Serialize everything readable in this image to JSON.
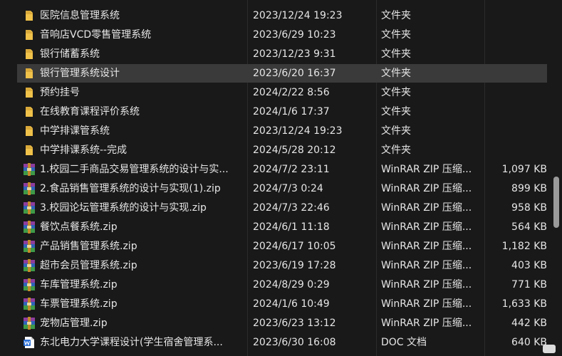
{
  "colors": {
    "background": "#191919",
    "selected_row": "#3a3a3a",
    "folder": "#f0c24a",
    "text": "#e6e6e6"
  },
  "files": [
    {
      "name": "医院信息管理系统",
      "date": "2023/12/24 19:23",
      "type": "文件夹",
      "size": "",
      "icon": "folder-icon"
    },
    {
      "name": "音响店VCD零售管理系统",
      "date": "2023/6/29 10:23",
      "type": "文件夹",
      "size": "",
      "icon": "folder-icon"
    },
    {
      "name": "银行储蓄系统",
      "date": "2023/12/23 9:31",
      "type": "文件夹",
      "size": "",
      "icon": "folder-icon"
    },
    {
      "name": "银行管理系统设计",
      "date": "2023/6/20 16:37",
      "type": "文件夹",
      "size": "",
      "icon": "folder-icon",
      "selected": true
    },
    {
      "name": "预约挂号",
      "date": "2024/2/22 8:56",
      "type": "文件夹",
      "size": "",
      "icon": "folder-icon"
    },
    {
      "name": "在线教育课程评价系统",
      "date": "2024/1/6 17:37",
      "type": "文件夹",
      "size": "",
      "icon": "folder-icon"
    },
    {
      "name": "中学排课管系统",
      "date": "2023/12/24 19:23",
      "type": "文件夹",
      "size": "",
      "icon": "folder-icon"
    },
    {
      "name": "中学排课系统--完成",
      "date": "2024/5/28 20:12",
      "type": "文件夹",
      "size": "",
      "icon": "folder-icon"
    },
    {
      "name": "1.校园二手商品交易管理系统的设计与实...",
      "date": "2024/7/2 23:11",
      "type": "WinRAR ZIP 压缩...",
      "size": "1,097 KB",
      "icon": "winrar-zip-icon"
    },
    {
      "name": "2.食品销售管理系统的设计与实现(1).zip",
      "date": "2024/7/3 0:24",
      "type": "WinRAR ZIP 压缩...",
      "size": "899 KB",
      "icon": "winrar-zip-icon"
    },
    {
      "name": "3.校园论坛管理系统的设计与实现.zip",
      "date": "2024/7/3 22:46",
      "type": "WinRAR ZIP 压缩...",
      "size": "958 KB",
      "icon": "winrar-zip-icon"
    },
    {
      "name": "餐饮点餐系统.zip",
      "date": "2024/6/1 11:18",
      "type": "WinRAR ZIP 压缩...",
      "size": "564 KB",
      "icon": "winrar-zip-icon"
    },
    {
      "name": "产品销售管理系统.zip",
      "date": "2024/6/17 10:05",
      "type": "WinRAR ZIP 压缩...",
      "size": "1,182 KB",
      "icon": "winrar-zip-icon"
    },
    {
      "name": "超市会员管理系统.zip",
      "date": "2023/6/19 17:28",
      "type": "WinRAR ZIP 压缩...",
      "size": "403 KB",
      "icon": "winrar-zip-icon"
    },
    {
      "name": "车库管理系统.zip",
      "date": "2024/8/29 0:29",
      "type": "WinRAR ZIP 压缩...",
      "size": "771 KB",
      "icon": "winrar-zip-icon"
    },
    {
      "name": "车票管理系统.zip",
      "date": "2024/1/6 10:49",
      "type": "WinRAR ZIP 压缩...",
      "size": "1,633 KB",
      "icon": "winrar-zip-icon"
    },
    {
      "name": "宠物店管理.zip",
      "date": "2023/6/23 13:12",
      "type": "WinRAR ZIP 压缩...",
      "size": "442 KB",
      "icon": "winrar-zip-icon"
    },
    {
      "name": "东北电力大学课程设计(学生宿舍管理系...",
      "date": "2023/6/30 16:08",
      "type": "DOC 文档",
      "size": "640 KB",
      "icon": "word-doc-icon"
    }
  ]
}
